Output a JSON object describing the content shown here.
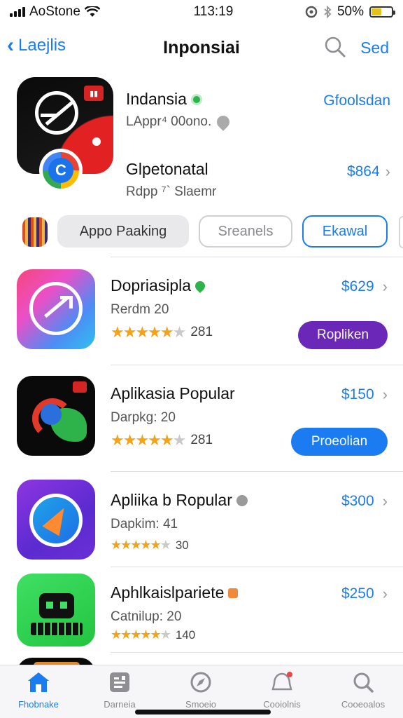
{
  "status_bar": {
    "carrier": "AoStone",
    "time": "113:19",
    "battery": "50%"
  },
  "nav": {
    "back_label": "Laejlis",
    "title": "Inponsiai",
    "action_label": "Sed"
  },
  "featured": {
    "primary": {
      "name": "Indansia",
      "subtitle": "LAppr⁴ 00ono.",
      "link": "Gfoolsdan"
    },
    "secondary": {
      "name": "Glpetonatal",
      "subtitle": "Rdpp ⁷` Slaemr",
      "price": "$864"
    }
  },
  "filters": {
    "chips": [
      "Appo Paaking",
      "Sreanels",
      "Ekawal"
    ],
    "selected": "Ekawal"
  },
  "apps": [
    {
      "name": "Dopriasipla",
      "subtitle": "Rerdm 20",
      "rating_value": 4.5,
      "rating_count": "281",
      "price": "$629",
      "button": "Ropliken",
      "button_color": "#6a27b8"
    },
    {
      "name": "Aplikasia Popular",
      "subtitle": "Darpkg: 20",
      "rating_value": 4.5,
      "rating_count": "281",
      "price": "$150",
      "button": "Proeolian",
      "button_color": "#1a7cf0"
    },
    {
      "name": "Apliika b Ropular",
      "subtitle": "Dapkim: 41",
      "rating_value": 4.5,
      "rating_count": "30",
      "price": "$300",
      "button": "",
      "button_color": ""
    },
    {
      "name": "Aphlkaislpariete",
      "subtitle": "Catnilup: 20",
      "rating_value": 4.5,
      "rating_count": "140",
      "price": "$250",
      "button": "",
      "button_color": ""
    }
  ],
  "tabs": [
    {
      "label": "Fhobnake",
      "icon": "home-icon",
      "active": true
    },
    {
      "label": "Darneia",
      "icon": "document-icon",
      "active": false
    },
    {
      "label": "Smoeio",
      "icon": "compass-icon",
      "active": false
    },
    {
      "label": "Cooiolnis",
      "icon": "notification-icon",
      "active": false
    },
    {
      "label": "Cooeoalos",
      "icon": "search-icon",
      "active": false
    }
  ],
  "colors": {
    "accent": "#1a7cf0",
    "star": "#f3a31a",
    "purple_button": "#6a27b8"
  }
}
